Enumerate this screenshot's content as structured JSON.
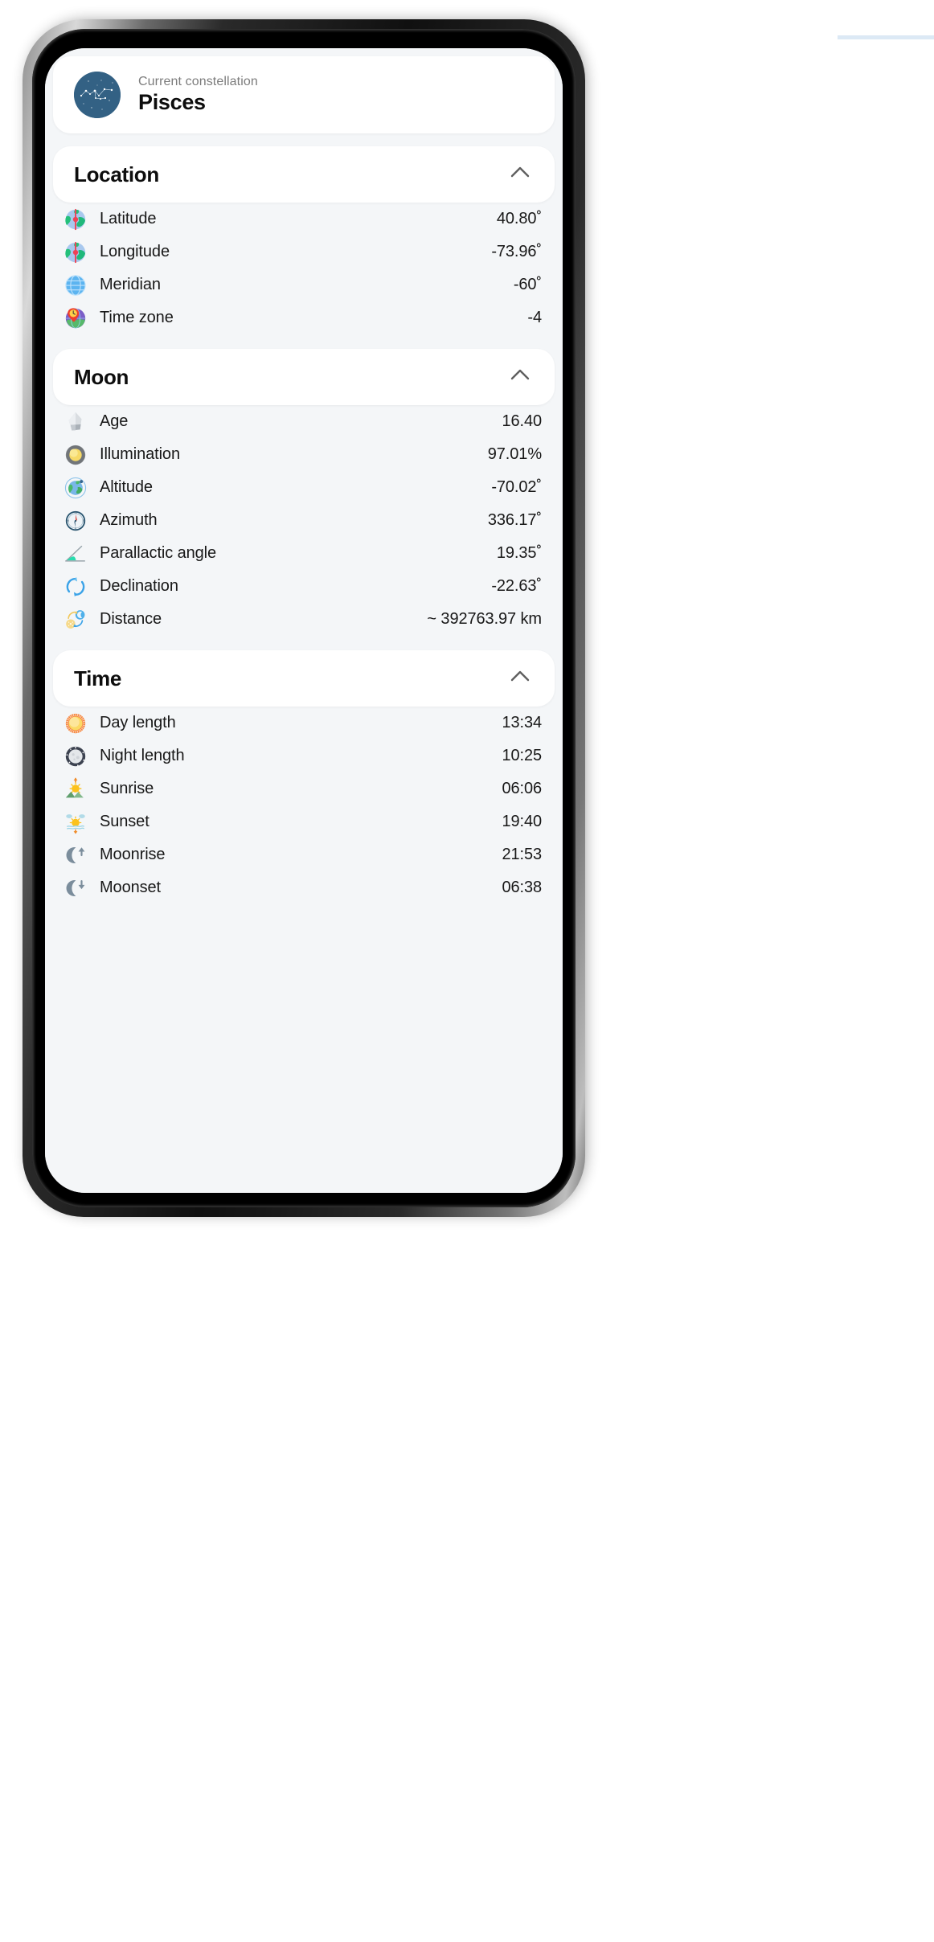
{
  "constellation": {
    "label": "Current constellation",
    "name": "Pisces",
    "icon": "constellation-orb-icon"
  },
  "sections": [
    {
      "id": "location",
      "title": "Location",
      "collapse_icon": "chevron-up-icon",
      "rows": [
        {
          "icon": "globe-latitude-icon",
          "label": "Latitude",
          "value": "40.80˚"
        },
        {
          "icon": "globe-longitude-icon",
          "label": "Longitude",
          "value": "-73.96˚"
        },
        {
          "icon": "globe-meridian-icon",
          "label": "Meridian",
          "value": "-60˚"
        },
        {
          "icon": "timezone-pin-icon",
          "label": "Time zone",
          "value": "-4"
        }
      ]
    },
    {
      "id": "moon",
      "title": "Moon",
      "collapse_icon": "chevron-up-icon",
      "rows": [
        {
          "icon": "moon-rock-icon",
          "label": "Age",
          "value": "16.40"
        },
        {
          "icon": "illumination-icon",
          "label": "Illumination",
          "value": "97.01%"
        },
        {
          "icon": "orbit-earth-icon",
          "label": "Altitude",
          "value": "-70.02˚"
        },
        {
          "icon": "compass-icon",
          "label": "Azimuth",
          "value": "336.17˚"
        },
        {
          "icon": "angle-icon",
          "label": "Parallactic angle",
          "value": "19.35˚"
        },
        {
          "icon": "rotation-arrows-icon",
          "label": "Declination",
          "value": "-22.63˚"
        },
        {
          "icon": "sun-moon-distance-icon",
          "label": "Distance",
          "value": "~ 392763.97 km"
        }
      ]
    },
    {
      "id": "time",
      "title": "Time",
      "collapse_icon": "chevron-up-icon",
      "rows": [
        {
          "icon": "sun-icon",
          "label": "Day length",
          "value": "13:34"
        },
        {
          "icon": "night-moon-icon",
          "label": "Night length",
          "value": "10:25"
        },
        {
          "icon": "sunrise-icon",
          "label": "Sunrise",
          "value": "06:06"
        },
        {
          "icon": "sunset-icon",
          "label": "Sunset",
          "value": "19:40"
        },
        {
          "icon": "moonrise-icon",
          "label": "Moonrise",
          "value": "21:53"
        },
        {
          "icon": "moonset-icon",
          "label": "Moonset",
          "value": "06:38"
        }
      ]
    }
  ],
  "colors": {
    "page_bg": "#f4f6f8",
    "card_bg": "#ffffff",
    "text": "#181818",
    "muted": "#7c7c7c",
    "constellation_orb": "#336184"
  }
}
